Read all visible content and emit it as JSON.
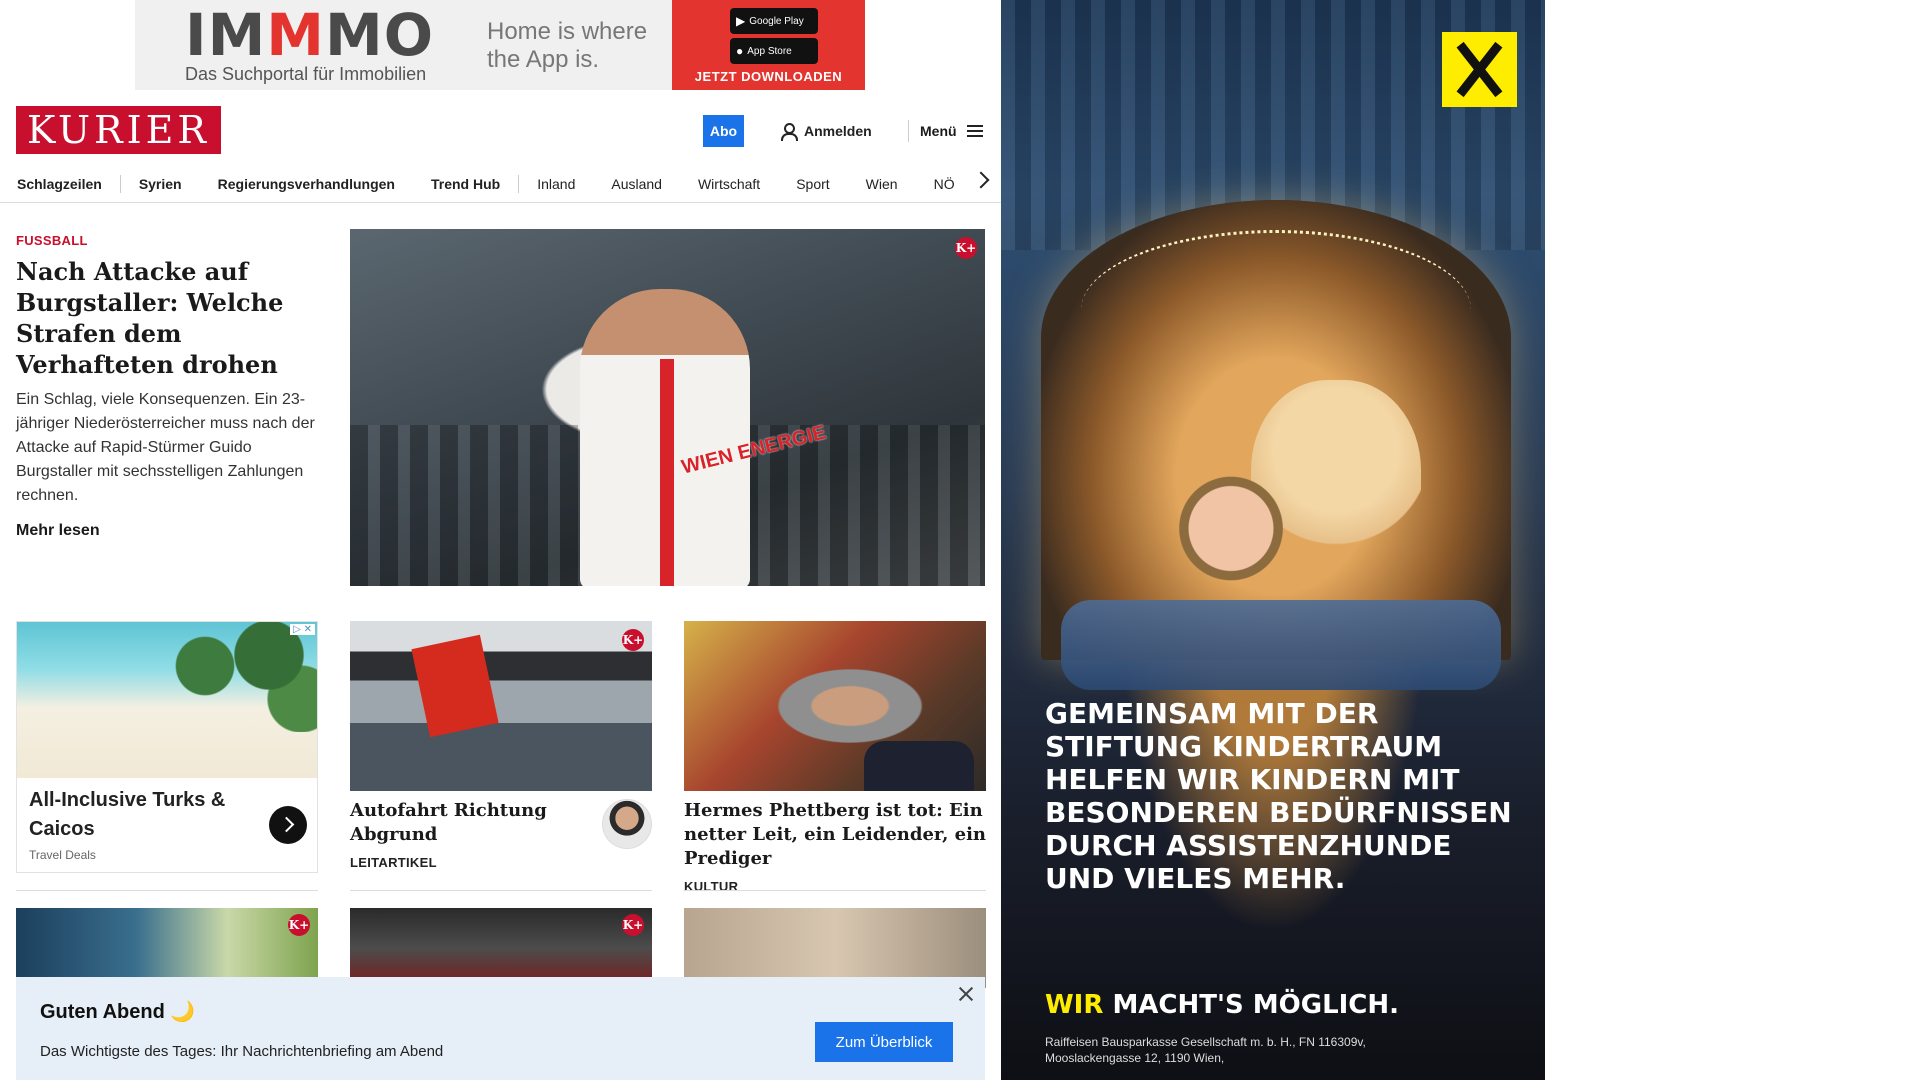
{
  "top_ad": {
    "logo_a": "IM",
    "logo_red": "M",
    "logo_b": "MO",
    "tagline": "Das Suchportal für Immobilien",
    "slogan": "Home is where the App is.",
    "google_play": "Google Play",
    "app_store": "App Store",
    "cta": "JETZT DOWNLOADEN"
  },
  "header": {
    "brand": "KURIER",
    "abo": "Abo",
    "login": "Anmelden",
    "menu": "Menü"
  },
  "nav": {
    "items": [
      "Schlagzeilen",
      "Syrien",
      "Regierungsverhandlungen",
      "Trend Hub",
      "Inland",
      "Ausland",
      "Wirtschaft",
      "Sport",
      "Wien",
      "NÖ"
    ]
  },
  "lead": {
    "kicker": "FUSSBALL",
    "title": "Nach Attacke auf Burg­staller: Welche Strafen dem Verhafteten drohen",
    "teaser": "Ein Schlag, viele Konsequenzen. Ein 23-jähriger Niederösterreicher muss nach der Attacke auf Rapid-Stürmer Guido Burgstaller mit sechsstelligen Zahlungen rechnen.",
    "more": "Mehr lesen",
    "badge": "K+",
    "image_sponsor": "WIEN ENERGIE"
  },
  "ad_card": {
    "title": "All-Inclusive Turks & Caicos",
    "source": "Travel Deals",
    "ad_marker": "▷ ✕"
  },
  "cards": [
    {
      "title": "Autofahrt Richtung Abgrund",
      "category": "LEITARTIKEL",
      "badge": "K+"
    },
    {
      "title": "Hermes Phettberg ist tot: Ein netter Leit, ein Leidender, ein Prediger",
      "category": "KULTUR"
    }
  ],
  "bottom_badges": [
    "K+",
    "K+"
  ],
  "briefing": {
    "greeting": "Guten Abend 🌙",
    "description": "Das Wichtigste des Tages: Ihr Nachrichtenbriefing am Abend",
    "button": "Zum Überblick"
  },
  "side_ad": {
    "headline": "GEMEINSAM MIT DER STIFTUNG KINDERTRAUM HELFEN WIR KINDERN MIT BESONDEREN BEDÜRFNISSEN DURCH ASSISTENZHUNDE UND VIELES MEHR.",
    "claim_yellow": "WIR",
    "claim_rest": "MACHT'S MÖGLICH.",
    "legal": "Raiffeisen Bausparkasse Gesellschaft m. b. H., FN 116309v, Mooslackengasse 12, 1190 Wien,"
  },
  "colors": {
    "brand_red": "#c8102e",
    "accent_blue": "#1a73e8",
    "briefing_bg": "#e6eef8",
    "raiffeisen_yellow": "#ffed00"
  }
}
